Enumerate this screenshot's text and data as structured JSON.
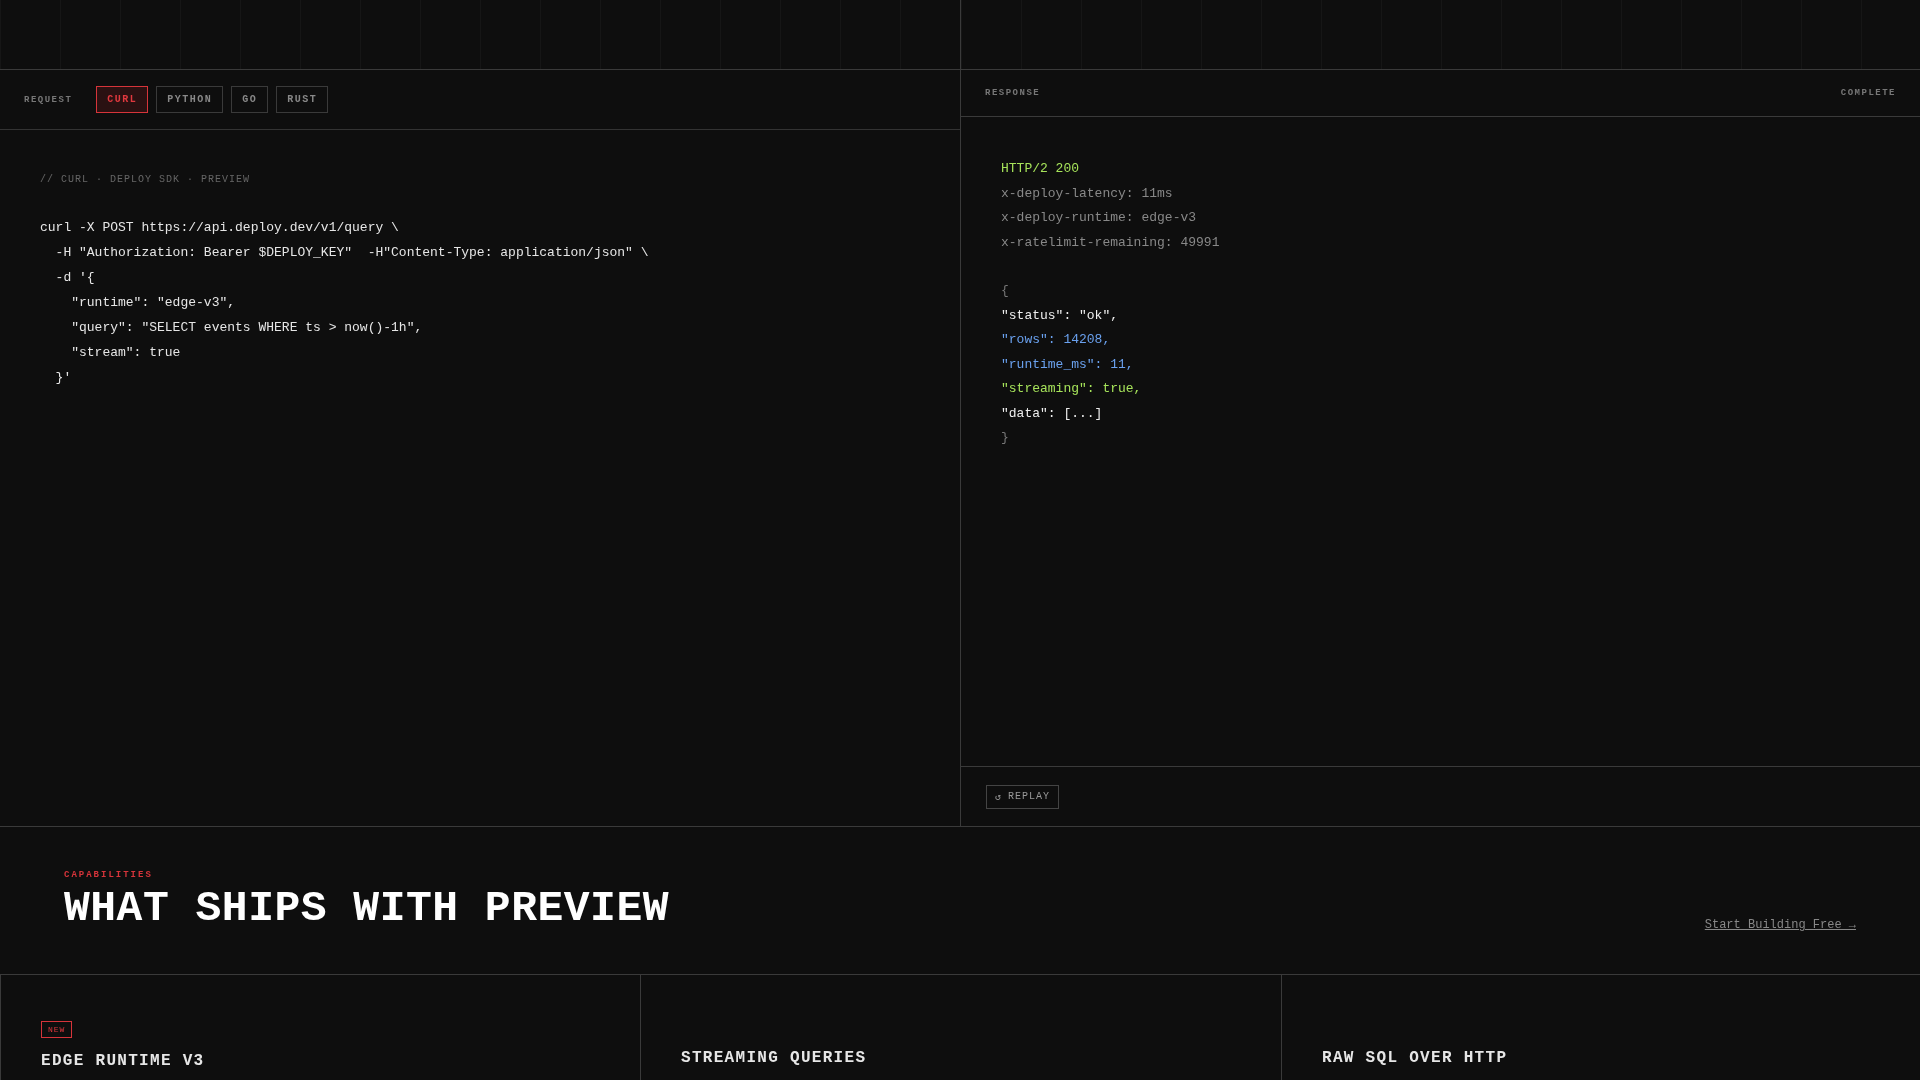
{
  "request": {
    "label": "REQUEST",
    "tabs": [
      {
        "label": "CURL",
        "selected": true
      },
      {
        "label": "PYTHON",
        "selected": false
      },
      {
        "label": "GO",
        "selected": false
      },
      {
        "label": "RUST",
        "selected": false
      }
    ],
    "comment": "// CURL · DEPLOY SDK · PREVIEW",
    "code": [
      "curl -X POST https://api.deploy.dev/v1/query \\",
      "  -H \"Authorization: Bearer $DEPLOY_KEY\"  -H\"Content-Type: application/json\" \\",
      "  -d '{",
      "    \"runtime\": \"edge-v3\",",
      "    \"query\": \"SELECT events WHERE ts > now()-1h\",",
      "    \"stream\": true",
      "  }'"
    ]
  },
  "response": {
    "label": "RESPONSE",
    "status": "COMPLETE",
    "headers": [
      {
        "text": "HTTP/2 200",
        "kind": "status"
      },
      {
        "text": "x-deploy-latency: 11ms",
        "kind": "header"
      },
      {
        "text": "x-deploy-runtime: edge-v3",
        "kind": "header"
      },
      {
        "text": "x-ratelimit-remaining: 49991",
        "kind": "header"
      }
    ],
    "body": [
      {
        "text": "{",
        "kind": "brace"
      },
      {
        "text": "\"status\": \"ok\",",
        "kind": "plain"
      },
      {
        "text": "\"rows\": 14208,",
        "kind": "number"
      },
      {
        "text": "\"runtime_ms\": 11,",
        "kind": "number"
      },
      {
        "text": "\"streaming\": true,",
        "kind": "bool"
      },
      {
        "text": "\"data\": [...]",
        "kind": "plain"
      },
      {
        "text": "}",
        "kind": "brace"
      }
    ],
    "replay_button": {
      "icon": "↺",
      "label": "REPLAY"
    }
  },
  "capabilities": {
    "eyebrow": "CAPABILITIES",
    "title": "WHAT SHIPS WITH PREVIEW",
    "link": "Start Building Free →",
    "cards": [
      {
        "badge": "NEW",
        "title": "EDGE RUNTIME V3"
      },
      {
        "title": "STREAMING QUERIES"
      },
      {
        "title": "RAW SQL OVER HTTP"
      }
    ]
  }
}
